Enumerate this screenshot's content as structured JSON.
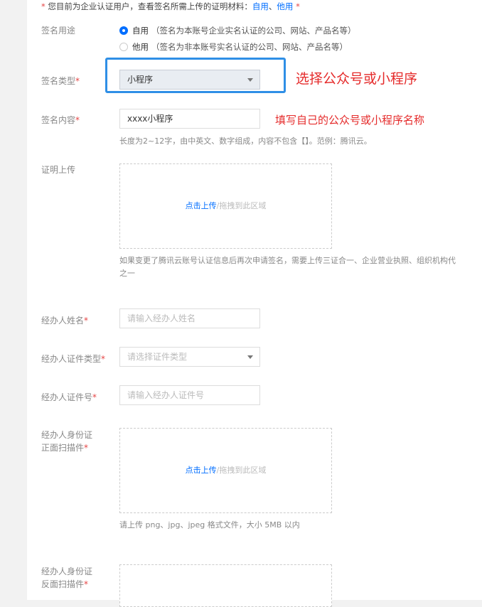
{
  "notice": {
    "star": "*",
    "text": "您目前为企业认证用户，查看签名所需上传的证明材料：",
    "link_self": "自用",
    "separator": "、",
    "link_other": "他用",
    "star2": "*"
  },
  "purpose": {
    "label": "签名用途",
    "options": [
      {
        "label": "自用",
        "desc": "（签名为本账号企业实名认证的公司、网站、产品名等）",
        "checked": true
      },
      {
        "label": "他用",
        "desc": "（签名为非本账号实名认证的公司、网站、产品名等）",
        "checked": false
      }
    ]
  },
  "sign_type": {
    "label": "签名类型",
    "value": "小程序",
    "annotation": "选择公众号或小程序"
  },
  "sign_content": {
    "label": "签名内容",
    "value": "xxxx小程序",
    "annotation": "填写自己的公众号或小程序名称",
    "hint": "长度为2~12字，由中英文、数字组成，内容不包含【】。范例：腾讯云。"
  },
  "proof_upload": {
    "label": "证明上传",
    "upload_link": "点击上传",
    "upload_rest": "/拖拽到此区域",
    "hint_line1": "如果变更了腾讯云账号认证信息后再次申请签名，需要上传三证合一、企业营业执照、组织机构代",
    "hint_line2": "之一"
  },
  "agent_name": {
    "label": "经办人姓名",
    "placeholder": "请输入经办人姓名"
  },
  "agent_id_type": {
    "label": "经办人证件类型",
    "placeholder": "请选择证件类型"
  },
  "agent_id_no": {
    "label": "经办人证件号",
    "placeholder": "请输入经办人证件号"
  },
  "id_front": {
    "label_line1": "经办人身份证",
    "label_line2": "正面扫描件",
    "upload_link": "点击上传",
    "upload_rest": "/拖拽到此区域",
    "hint": "请上传 png、jpg、jpeg 格式文件，大小 5MB 以内"
  },
  "id_back": {
    "label_line1": "经办人身份证",
    "label_line2": "反面扫描件"
  },
  "required_mark": "*"
}
